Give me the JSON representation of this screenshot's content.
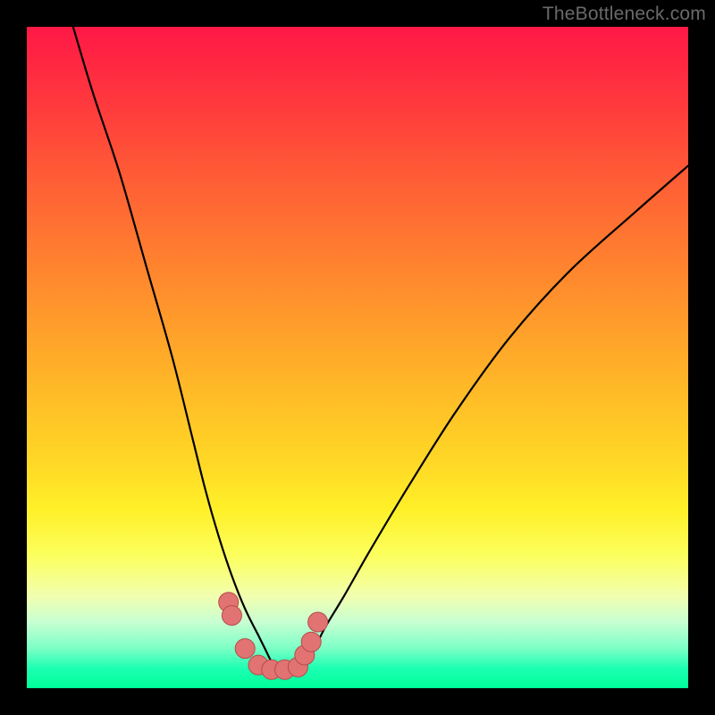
{
  "watermark": "TheBottleneck.com",
  "chart_data": {
    "type": "line",
    "title": "",
    "xlabel": "",
    "ylabel": "",
    "xlim": [
      0,
      100
    ],
    "ylim": [
      0,
      100
    ],
    "series": [
      {
        "name": "bottleneck-curve",
        "x": [
          7,
          10,
          14,
          18,
          22,
          25,
          27,
          29,
          31,
          33,
          35,
          36,
          37,
          38,
          39,
          40,
          41,
          43,
          45,
          48,
          52,
          58,
          65,
          73,
          82,
          92,
          100
        ],
        "y": [
          100,
          90,
          78,
          64,
          50,
          38,
          30,
          23,
          17,
          12,
          8,
          6,
          4,
          3,
          2.5,
          2.5,
          3,
          5,
          9,
          14,
          21,
          31,
          42,
          53,
          63,
          72,
          79
        ]
      },
      {
        "name": "marker-cluster",
        "x": [
          30.5,
          31,
          33,
          35,
          37,
          39,
          41,
          42,
          43,
          44
        ],
        "y": [
          13,
          11,
          6,
          3.5,
          2.8,
          2.8,
          3.2,
          5,
          7,
          10
        ]
      }
    ],
    "colors": {
      "curve": "#000000",
      "markers_fill": "#e17372",
      "markers_stroke": "#b74b4c"
    },
    "background_gradient": {
      "top": "#ff1846",
      "bottom": "#00ff99"
    }
  }
}
